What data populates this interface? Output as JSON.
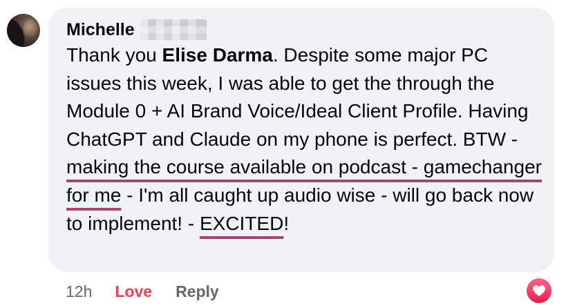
{
  "comment": {
    "author": "Michelle",
    "text": {
      "p1": "Thank you ",
      "mention": "Elise Darma",
      "p2": ". Despite some major PC issues this week, I was able to get the through the Module 0 + AI Brand Voice/Ideal Client Profile. Having ChatGPT and Claude on my phone is perfect. BTW - ",
      "highlight1": "making the course available on podcast - gamechanger for me",
      "p3": " - I'm all caught up audio wise - will go back now to implement! - ",
      "highlight2": "EXCITED",
      "p4": "!"
    },
    "underline_color": "#9c4a72"
  },
  "actions": {
    "time": "12h",
    "love_label": "Love",
    "reply_label": "Reply"
  },
  "reaction": {
    "icon": "heart-icon",
    "color": "#f33e58"
  },
  "colors": {
    "bubble": "#f0f2f5",
    "love": "#f33e58",
    "muted": "#65676b"
  }
}
